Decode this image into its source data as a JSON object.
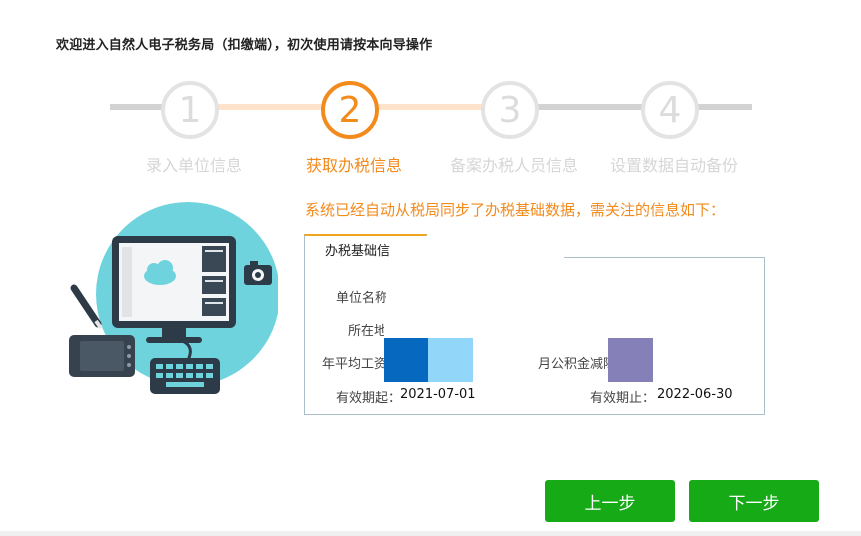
{
  "wizard": {
    "title": "欢迎进入自然人电子税务局（扣缴端），初次使用请按本向导操作",
    "steps": [
      {
        "number": "1",
        "label": "录入单位信息",
        "state": "done"
      },
      {
        "number": "2",
        "label": "获取办税信息",
        "state": "active"
      },
      {
        "number": "3",
        "label": "备案办税人员信息",
        "state": "pending"
      },
      {
        "number": "4",
        "label": "设置数据自动备份",
        "state": "pending"
      }
    ],
    "notice": "系统已经自动从税局同步了办税基础数据，需关注的信息如下：",
    "panel": {
      "tab_label": "办税基础信",
      "fields": {
        "unit_name_label": "单位名称",
        "location_label": "所在地",
        "avg_salary_label": "年平均工资",
        "fund_label": "月公积金减除",
        "valid_from_label": "有效期起：",
        "valid_from_value": "2021-07-01",
        "valid_to_label": "有效期止：",
        "valid_to_value": "2022-06-30"
      }
    },
    "buttons": {
      "prev": "上一步",
      "next": "下一步"
    }
  },
  "colors": {
    "accent": "#f28a1c",
    "primary_button": "#16aa16",
    "inactive": "#e3e3e3",
    "progress_done": "#fde3cb",
    "redact_blue_dark": "#0768c0",
    "redact_blue_light": "#92d6fa",
    "redact_purple": "#8580b7"
  }
}
